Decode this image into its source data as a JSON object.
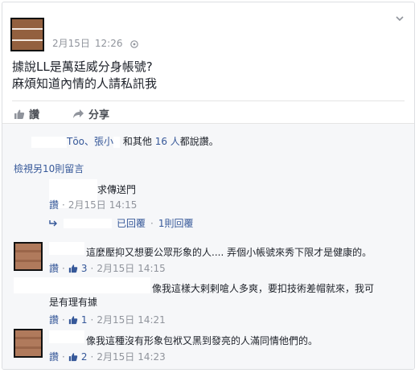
{
  "post": {
    "date": "2月15日",
    "time": "12:26",
    "line1": "據說LL是萬廷威分身帳號?",
    "line2": "麻煩知道內情的人請私訊我"
  },
  "actions": {
    "like_label": "讚",
    "share_label": "分享"
  },
  "likes": {
    "name1": "Tōo",
    "sep": "、張小",
    "and_others": "和其他",
    "count_link": "16 人",
    "suffix": "都說讚。"
  },
  "more_comments_label": "檢視另10則留言",
  "comments": [
    {
      "text": "求傳送門",
      "like_label": "讚",
      "date": "2月15日",
      "time": "14:15",
      "reply_author": "已回覆",
      "reply_count": "1則回覆"
    },
    {
      "text": "這麼壓抑又想要公眾形象的人.... 弄個小帳號來秀下限才是健康的。",
      "like_label": "讚",
      "likes": "3",
      "date": "2月15日",
      "time": "14:15"
    },
    {
      "text_line1": "像我這樣大剌剌嗆人多爽，要扣技術差帽就來，我可",
      "text_line2": "是有理有據",
      "like_label": "讚",
      "likes": "1",
      "date": "2月15日",
      "time": "14:21"
    },
    {
      "text": "像我這種沒有形象包袱又黑到發亮的人滿同情他們的。",
      "like_label": "讚",
      "likes": "2",
      "date": "2月15日",
      "time": "14:23"
    }
  ],
  "colors": {
    "link": "#365899",
    "meta": "#90949c",
    "panel": "#f6f7f9"
  }
}
